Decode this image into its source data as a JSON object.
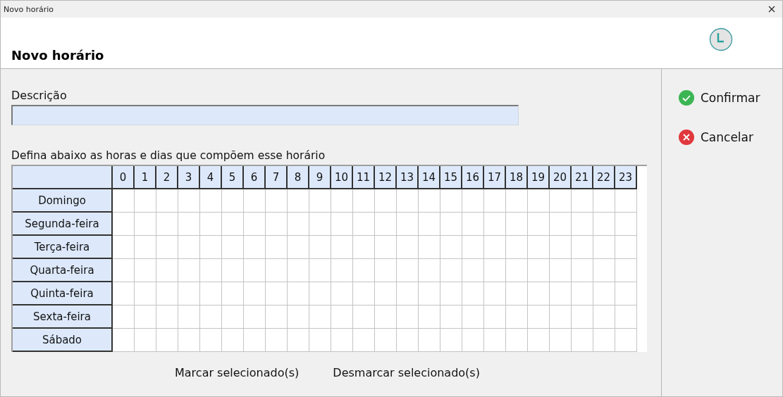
{
  "window": {
    "title": "Novo horário"
  },
  "header": {
    "title": "Novo horário"
  },
  "description": {
    "label": "Descrição"
  },
  "schedule": {
    "instruction": "Defina abaixo as horas e dias que compõem esse horário",
    "hours": [
      "0",
      "1",
      "2",
      "3",
      "4",
      "5",
      "6",
      "7",
      "8",
      "9",
      "10",
      "11",
      "12",
      "13",
      "14",
      "15",
      "16",
      "17",
      "18",
      "19",
      "20",
      "21",
      "22",
      "23"
    ],
    "days": [
      "Domingo",
      "Segunda-feira",
      "Terça-feira",
      "Quarta-feira",
      "Quinta-feira",
      "Sexta-feira",
      "Sábado"
    ]
  },
  "grid_buttons": [
    "Marcar selecionado(s)",
    "Desmarcar selecionado(s)"
  ],
  "actions": [
    {
      "kind": "confirm",
      "label": "Confirmar"
    },
    {
      "kind": "cancel",
      "label": "Cancelar"
    }
  ]
}
